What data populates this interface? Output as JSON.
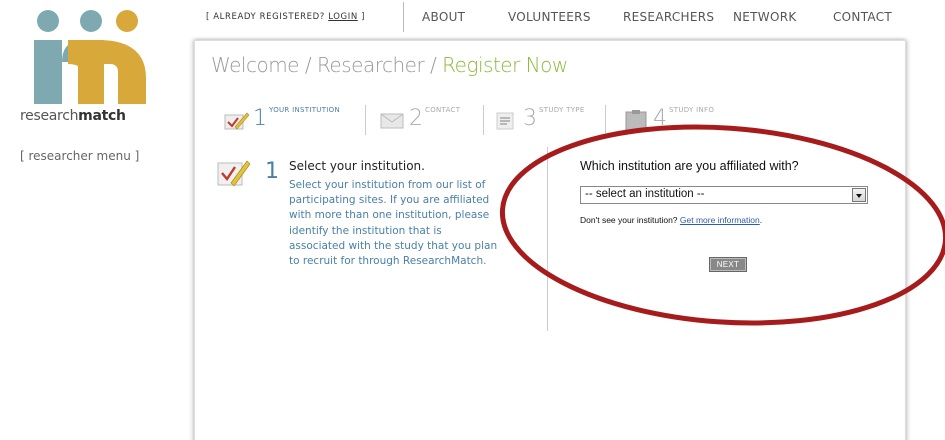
{
  "logo": {
    "brand_light": "research",
    "brand_bold": "match",
    "colors": {
      "teal": "#7fa9b1",
      "gold": "#d8a93a"
    }
  },
  "sidebar": {
    "researcher_menu": "[ researcher menu ]"
  },
  "top_nav": {
    "already_prefix": "[ ALREADY REGISTERED? ",
    "login_link": "LOGIN",
    "already_suffix": " ]",
    "items": [
      {
        "label": "ABOUT"
      },
      {
        "label": "VOLUNTEERS"
      },
      {
        "label": "RESEARCHERS"
      },
      {
        "label": "NETWORK"
      },
      {
        "label": "CONTACT"
      }
    ]
  },
  "breadcrumb": {
    "part1": "Welcome",
    "sep": " / ",
    "part2": "Researcher",
    "current": "Register Now"
  },
  "steps": [
    {
      "num": "1",
      "label": "YOUR INSTITUTION",
      "icon": "pencil-checklist-icon",
      "active": true
    },
    {
      "num": "2",
      "label": "CONTACT",
      "icon": "envelope-icon",
      "active": false
    },
    {
      "num": "3",
      "label": "STUDY TYPE",
      "icon": "list-icon",
      "active": false
    },
    {
      "num": "4",
      "label": "STUDY INFO",
      "icon": "clipboard-icon",
      "active": false
    }
  ],
  "instructions": {
    "num": "1",
    "title": "Select your institution.",
    "body": "Select your institution from our list of participating sites. If you are affiliated with more than one institution, please identify the institution that is associated with the study that you plan to recruit for through ResearchMatch."
  },
  "form": {
    "question": "Which institution are you affiliated with?",
    "select_value": "-- select an institution --",
    "help_prefix": "Don't see your institution? ",
    "help_link": "Get more information",
    "help_suffix": ".",
    "next_label": "NEXT"
  },
  "colors": {
    "accent_green": "#8cb93a",
    "step_blue": "#4a7fa8",
    "annotation_red": "#a61b1b"
  }
}
